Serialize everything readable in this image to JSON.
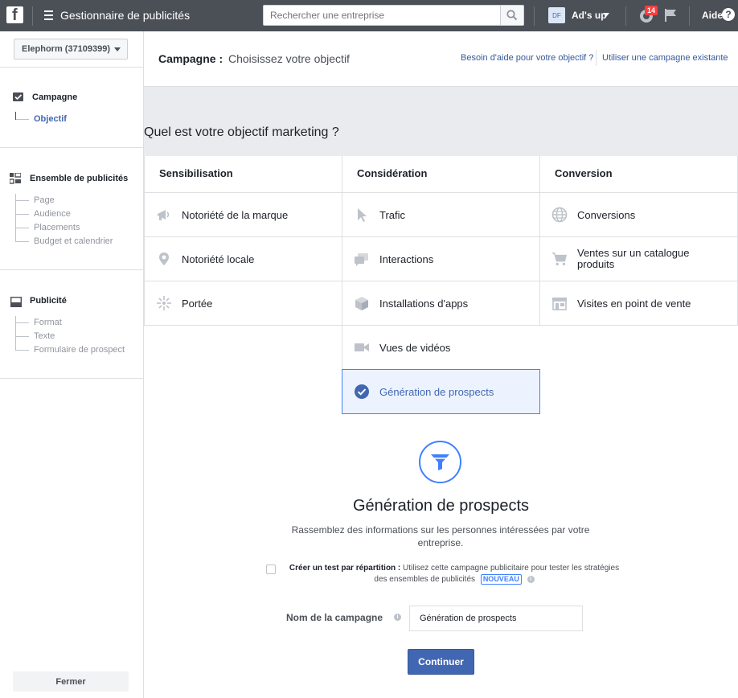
{
  "topbar": {
    "logo_letter": "f",
    "app_title": "Gestionnaire de publicités",
    "search_placeholder": "Rechercher une entreprise",
    "account_badge": "DF",
    "account_name": "Ad's up",
    "notification_count": "14",
    "help_label": "Aide",
    "help_symbol": "?"
  },
  "sidebar": {
    "account_selector": "Elephorm (37109399)",
    "sections": {
      "campaign": {
        "title": "Campagne",
        "items": [
          "Objectif"
        ],
        "active": "Objectif"
      },
      "adset": {
        "title": "Ensemble de publicités",
        "items": [
          "Page",
          "Audience",
          "Placements",
          "Budget et calendrier"
        ]
      },
      "ad": {
        "title": "Publicité",
        "items": [
          "Format",
          "Texte",
          "Formulaire de prospect"
        ]
      }
    },
    "close_label": "Fermer"
  },
  "header": {
    "campaign_label": "Campagne :",
    "campaign_subtitle": "Choisissez votre objectif",
    "help_link": "Besoin d'aide pour votre objectif ?",
    "existing_link": "Utiliser une campagne existante"
  },
  "objectives": {
    "question": "Quel est votre objectif marketing ?",
    "columns": [
      {
        "title": "Sensibilisation",
        "items": [
          {
            "label": "Notoriété de la marque",
            "icon": "megaphone-icon"
          },
          {
            "label": "Notoriété locale",
            "icon": "location-pin-icon"
          },
          {
            "label": "Portée",
            "icon": "reach-icon"
          }
        ]
      },
      {
        "title": "Considération",
        "items": [
          {
            "label": "Trafic",
            "icon": "cursor-icon"
          },
          {
            "label": "Interactions",
            "icon": "chat-bubbles-icon"
          },
          {
            "label": "Installations d'apps",
            "icon": "box-icon"
          },
          {
            "label": "Vues de vidéos",
            "icon": "video-camera-icon"
          },
          {
            "label": "Génération de prospects",
            "icon": "check-circle-icon",
            "selected": true
          }
        ]
      },
      {
        "title": "Conversion",
        "items": [
          {
            "label": "Conversions",
            "icon": "globe-icon"
          },
          {
            "label": "Ventes sur un catalogue produits",
            "icon": "cart-icon"
          },
          {
            "label": "Visites en point de vente",
            "icon": "store-icon"
          }
        ]
      }
    ]
  },
  "detail": {
    "icon": "funnel-icon",
    "title": "Génération de prospects",
    "description": "Rassemblez des informations sur les personnes intéressées par votre entreprise.",
    "split_test_label": "Créer un test par répartition :",
    "split_test_text": "Utilisez cette campagne publicitaire pour tester les stratégies des ensembles de publicités",
    "new_badge": "NOUVEAU",
    "info_symbol": "i",
    "split_test_checked": false,
    "campaign_name_label": "Nom de la campagne",
    "campaign_name_value": "Génération de prospects",
    "continue_label": "Continuer"
  },
  "colors": {
    "topbar": "#4b4f56",
    "accent": "#4267b2",
    "selected_bg": "#ecf3ff",
    "selected_border": "#4080ff",
    "icon_grey": "#bec2c9"
  }
}
